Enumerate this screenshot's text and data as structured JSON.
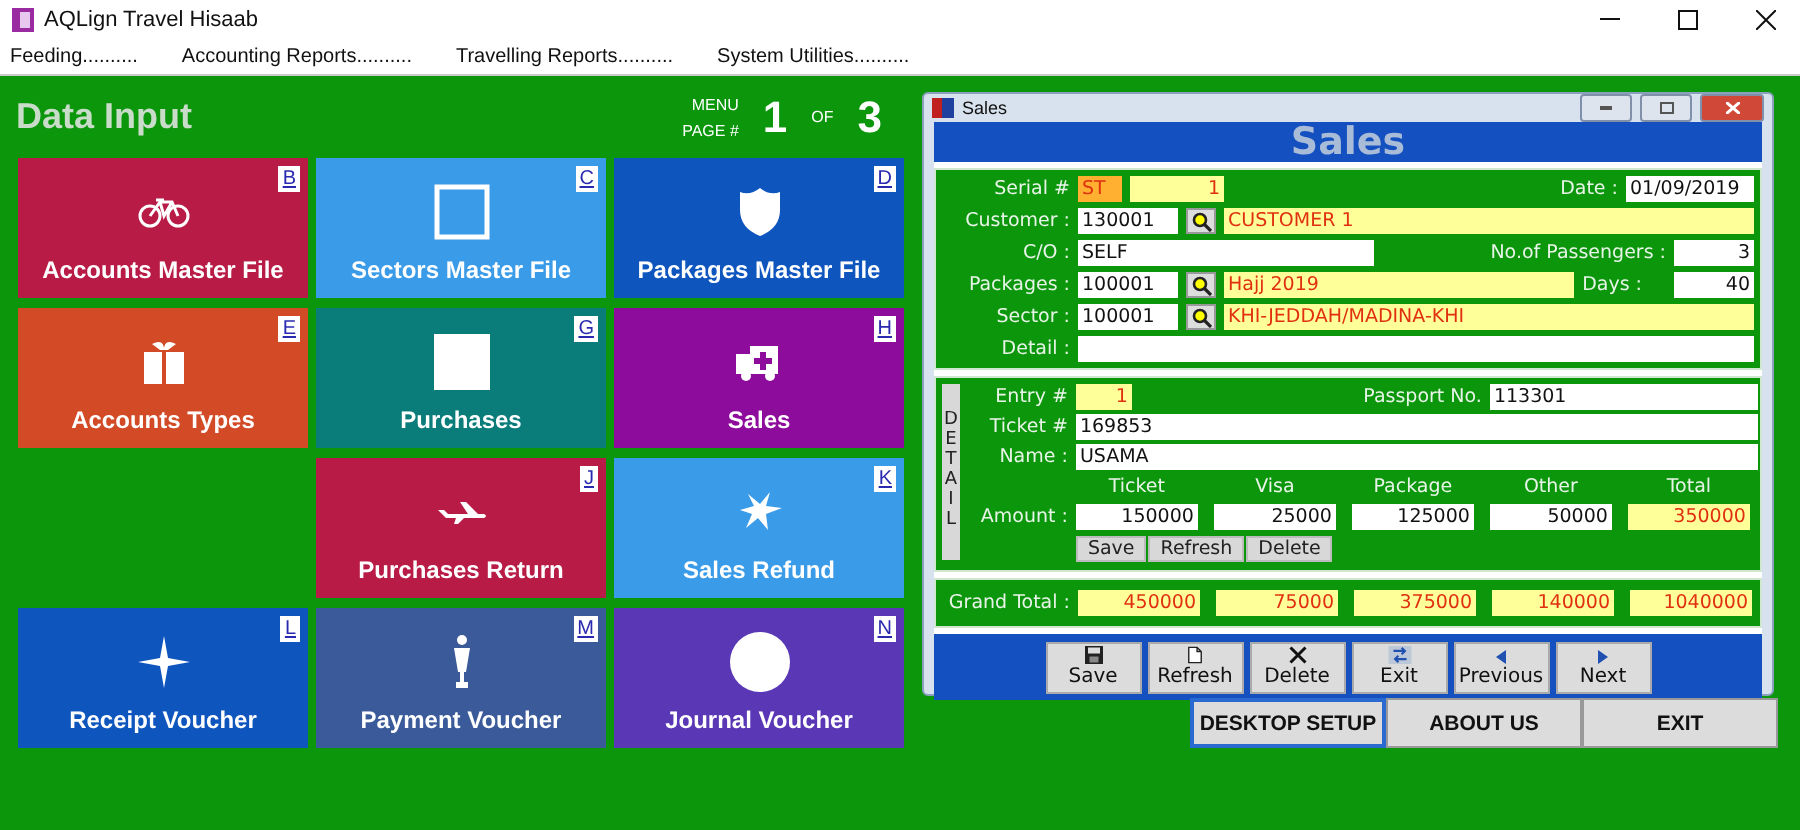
{
  "window": {
    "title": "AQLign Travel Hisaab"
  },
  "menu": [
    "Feeding..........",
    "Accounting Reports..........",
    "Travelling Reports..........",
    "System Utilities.........."
  ],
  "section_title": "Data Input",
  "menu_page": {
    "label_top": "MENU",
    "label_bottom": "PAGE #",
    "current": "1",
    "of": "OF",
    "total": "3"
  },
  "tile_rows": [
    [
      {
        "label": "Accounts Master File",
        "shortcut": "B",
        "color": "#b81c46"
      },
      {
        "label": "Sectors Master File",
        "shortcut": "C",
        "color": "#3a9be8"
      },
      {
        "label": "Packages Master File",
        "shortcut": "D",
        "color": "#0f55be"
      }
    ],
    [
      {
        "label": "Accounts Types",
        "shortcut": "E",
        "color": "#d24a26"
      },
      {
        "label": "Purchases",
        "shortcut": "G",
        "color": "#0a7d7a"
      },
      {
        "label": "Sales",
        "shortcut": "H",
        "color": "#8e0c9c"
      }
    ],
    [
      {
        "label": "Purchases Return",
        "shortcut": "J",
        "color": "#b81c46"
      },
      {
        "label": "Sales Refund",
        "shortcut": "K",
        "color": "#3a9be8"
      }
    ],
    [
      {
        "label": "Receipt Voucher",
        "shortcut": "L",
        "color": "#0f55be"
      },
      {
        "label": "Payment Voucher",
        "shortcut": "M",
        "color": "#3a5a9a"
      },
      {
        "label": "Journal Voucher",
        "shortcut": "N",
        "color": "#5a37b5"
      }
    ]
  ],
  "sales_window": {
    "title": "Sales",
    "heading": "Sales",
    "header": {
      "serial_label": "Serial #",
      "serial_prefix": "ST",
      "serial_number": "1",
      "date_label": "Date :",
      "date": "01/09/2019",
      "customer_label": "Customer :",
      "customer_code": "130001",
      "customer_name": "CUSTOMER 1",
      "co_label": "C/O :",
      "co": "SELF",
      "passengers_label": "No.of Passengers :",
      "passengers": "3",
      "packages_label": "Packages :",
      "package_code": "100001",
      "package_name": "Hajj 2019",
      "days_label": "Days :",
      "days": "40",
      "sector_label": "Sector :",
      "sector_code": "100001",
      "sector_name": "KHI-JEDDAH/MADINA-KHI",
      "detail_label": "Detail :"
    },
    "detail": {
      "side_label": "DETAIL",
      "entry_label": "Entry #",
      "entry": "1",
      "passport_label": "Passport No.",
      "passport": "113301",
      "ticket_label": "Ticket #",
      "ticket": "169853",
      "name_label": "Name :",
      "name": "USAMA",
      "amount_label": "Amount :",
      "amount_columns": [
        "Ticket",
        "Visa",
        "Package",
        "Other",
        "Total"
      ],
      "amounts": [
        {
          "value": "150000",
          "readonly": false
        },
        {
          "value": "25000",
          "readonly": false
        },
        {
          "value": "125000",
          "readonly": false
        },
        {
          "value": "50000",
          "readonly": false
        },
        {
          "value": "350000",
          "readonly": true
        }
      ],
      "buttons": [
        "Save",
        "Refresh",
        "Delete"
      ]
    },
    "grand_total_label": "Grand Total :",
    "grand_totals": [
      "450000",
      "75000",
      "375000",
      "140000",
      "1040000"
    ],
    "toolbar": [
      {
        "label": "Save",
        "kind": "save"
      },
      {
        "label": "Refresh",
        "kind": "refresh"
      },
      {
        "label": "Delete",
        "kind": "delete"
      },
      {
        "label": "Exit",
        "kind": "exit"
      },
      {
        "label": "Previous",
        "kind": "previous"
      },
      {
        "label": "Next",
        "kind": "next"
      }
    ]
  },
  "bottom_buttons": [
    {
      "label": "DESKTOP SETUP",
      "focused": true
    },
    {
      "label": "ABOUT US",
      "focused": false
    },
    {
      "label": "EXIT",
      "focused": false
    }
  ]
}
